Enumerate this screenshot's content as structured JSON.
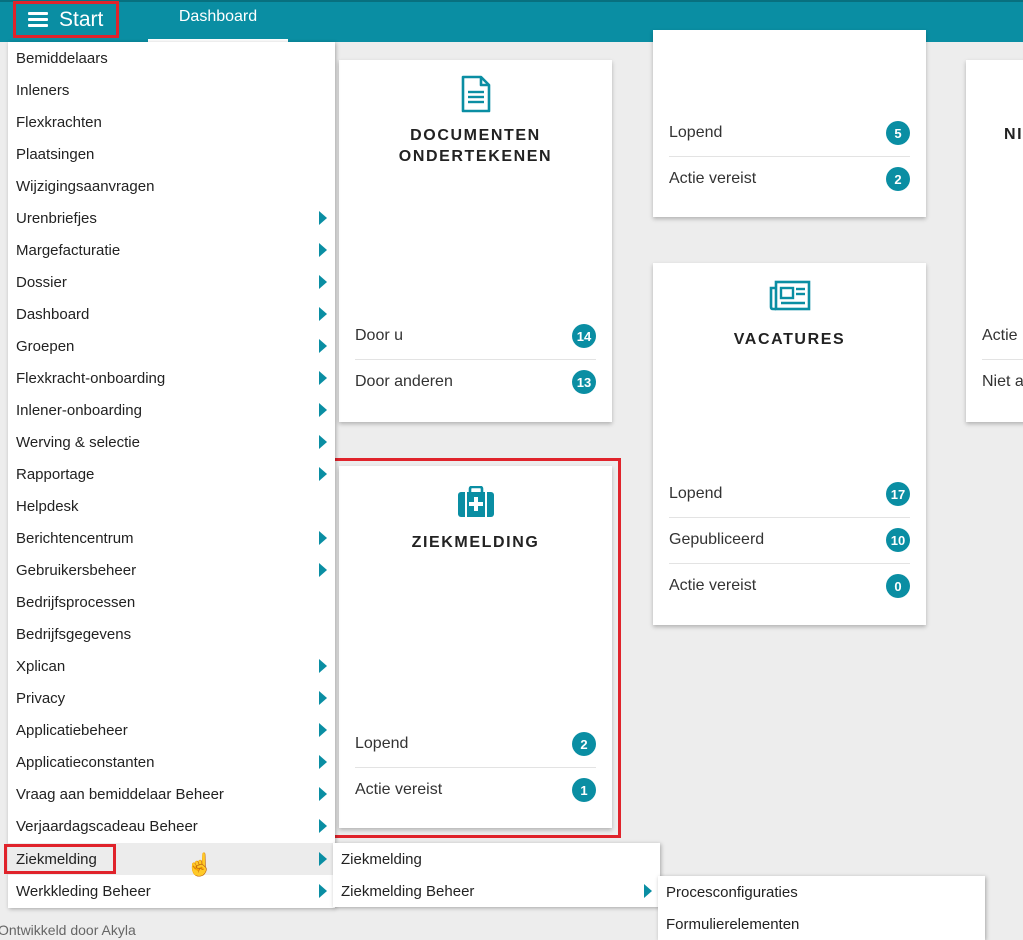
{
  "topbar": {
    "start_label": "Start",
    "dashboard_tab": "Dashboard"
  },
  "cards": {
    "documenten": {
      "title_line1": "DOCUMENTEN",
      "title_line2": "ONDERTEKENEN",
      "rows": [
        {
          "label": "Door u",
          "count": "14"
        },
        {
          "label": "Door anderen",
          "count": "13"
        }
      ]
    },
    "top_middle": {
      "rows": [
        {
          "label": "Lopend",
          "count": "5"
        },
        {
          "label": "Actie vereist",
          "count": "2"
        }
      ]
    },
    "vacatures": {
      "title": "VACATURES",
      "rows": [
        {
          "label": "Lopend",
          "count": "17"
        },
        {
          "label": "Gepubliceerd",
          "count": "10"
        },
        {
          "label": "Actie vereist",
          "count": "0"
        }
      ]
    },
    "ziekmelding": {
      "title": "ZIEKMELDING",
      "rows": [
        {
          "label": "Lopend",
          "count": "2"
        },
        {
          "label": "Actie vereist",
          "count": "1"
        }
      ]
    },
    "right_partial": {
      "title_fragment": "NI",
      "rows": [
        {
          "label": "Actie"
        },
        {
          "label": "Niet a"
        }
      ]
    }
  },
  "menu": {
    "items": [
      {
        "label": "Bemiddelaars"
      },
      {
        "label": "Inleners"
      },
      {
        "label": "Flexkrachten"
      },
      {
        "label": "Plaatsingen"
      },
      {
        "label": "Wijzigingsaanvragen"
      },
      {
        "label": "Urenbriefjes"
      },
      {
        "label": "Margefacturatie"
      },
      {
        "label": "Dossier"
      },
      {
        "label": "Dashboard"
      },
      {
        "label": "Groepen"
      },
      {
        "label": "Flexkracht-onboarding"
      },
      {
        "label": "Inlener-onboarding"
      },
      {
        "label": "Werving & selectie"
      },
      {
        "label": "Rapportage"
      },
      {
        "label": "Helpdesk"
      },
      {
        "label": "Berichtencentrum"
      },
      {
        "label": "Gebruikersbeheer"
      },
      {
        "label": "Bedrijfsprocessen"
      },
      {
        "label": "Bedrijfsgegevens"
      },
      {
        "label": "Xplican"
      },
      {
        "label": "Privacy"
      },
      {
        "label": "Applicatiebeheer"
      },
      {
        "label": "Applicatieconstanten"
      },
      {
        "label": "Vraag aan bemiddelaar Beheer"
      },
      {
        "label": "Verjaardagscadeau Beheer"
      },
      {
        "label": "Ziekmelding"
      },
      {
        "label": "Werkkleding Beheer"
      }
    ]
  },
  "submenu_ziekmelding": {
    "items": [
      {
        "label": "Ziekmelding"
      },
      {
        "label": "Ziekmelding Beheer"
      }
    ]
  },
  "submenu_beheer": {
    "items": [
      {
        "label": "Procesconfiguraties"
      },
      {
        "label": "Formulierelementen"
      }
    ]
  },
  "footer": {
    "text": "Ontwikkeld door Akyla"
  },
  "colors": {
    "accent": "#0a8ea3",
    "highlight": "#e0232b"
  },
  "icons": {
    "start": "hamburger-menu-icon",
    "documenten": "document-icon",
    "vacatures": "newspaper-icon",
    "ziekmelding": "medical-kit-icon",
    "cursor": "hand-pointer-icon",
    "submenu": "caret-right-icon"
  }
}
